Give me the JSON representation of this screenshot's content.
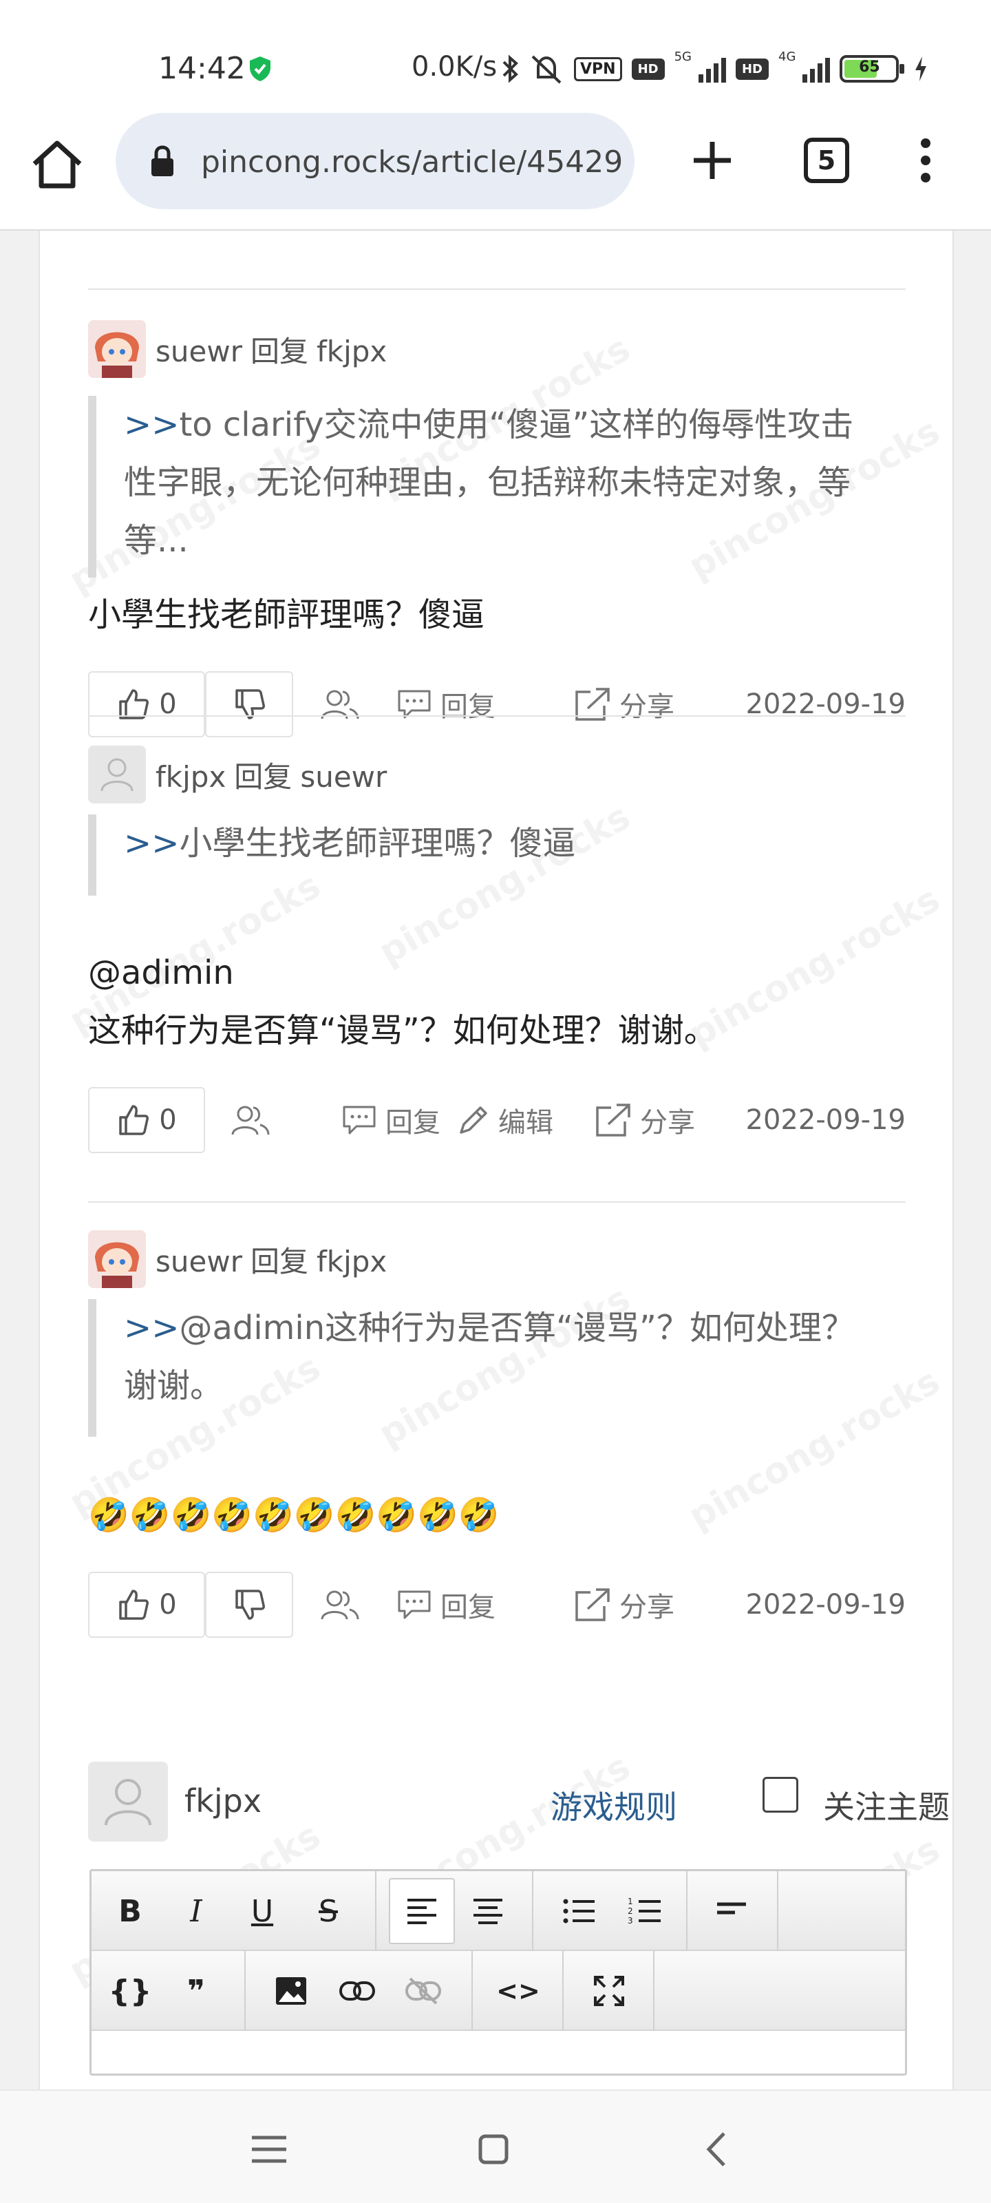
{
  "status_bar": {
    "time": "14:42",
    "net_speed": "0.0K/s",
    "vpn_label": "VPN",
    "hd1": "HD",
    "net1": "5G",
    "hd2": "HD",
    "net2": "4G",
    "battery": "65"
  },
  "browser": {
    "url": "pincong.rocks/article/45429",
    "tab_count": "5"
  },
  "watermark_text": "pincong.rocks",
  "comments": [
    {
      "author": "suewr",
      "reply_word": "回复",
      "reply_to": "fkjpx",
      "quote_prefix": ">>",
      "quote_text": "to clarify交流中使用“傻逼”这样的侮辱性攻击性字眼，无论何种理由，包括辩称未特定对象，等等...",
      "body": "小學生找老師評理嗎？傻逼",
      "votes": "0",
      "reply_label": "回复",
      "share_label": "分享",
      "date": "2022-09-19"
    },
    {
      "author": "fkjpx",
      "reply_word": "回复",
      "reply_to": "suewr",
      "quote_prefix": ">>",
      "quote_text": "小學生找老師評理嗎？傻逼",
      "body_line1": "@adimin",
      "body_line2": "这种行为是否算“谩骂”？如何处理？谢谢。",
      "votes": "0",
      "reply_label": "回复",
      "edit_label": "编辑",
      "share_label": "分享",
      "date": "2022-09-19"
    },
    {
      "author": "suewr",
      "reply_word": "回复",
      "reply_to": "fkjpx",
      "quote_prefix": ">>",
      "quote_text": "@adimin这种行为是否算“谩骂”？如何处理？谢谢。",
      "body": "🤣🤣🤣🤣🤣🤣🤣🤣🤣🤣",
      "votes": "0",
      "reply_label": "回复",
      "share_label": "分享",
      "date": "2022-09-19"
    }
  ],
  "reply_form": {
    "username": "fkjpx",
    "rules_link": "游戏规则",
    "follow_label": "关注主题"
  },
  "editor_toolbar": {
    "bold": "B",
    "italic": "I",
    "underline": "U",
    "strike": "S",
    "code": "{}",
    "quote": "❞",
    "source": "<>"
  },
  "colors": {
    "link": "#2a5d8f",
    "quote_bar": "#dadada",
    "battery": "#7ed957",
    "shield": "#19b955"
  }
}
